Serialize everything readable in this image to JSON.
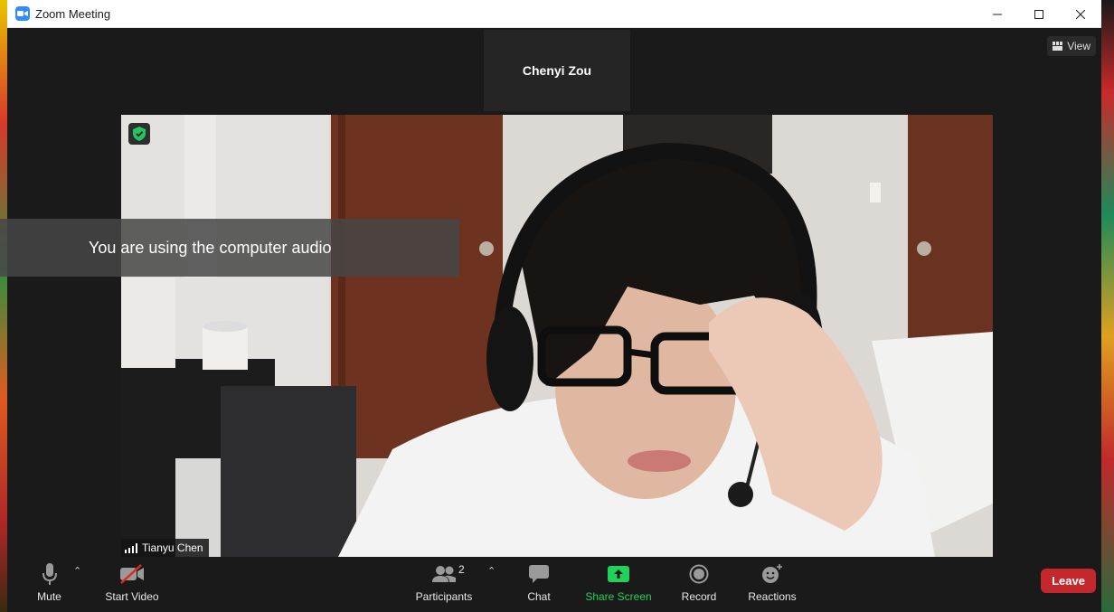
{
  "window": {
    "title": "Zoom Meeting"
  },
  "speaker": {
    "name": "Chenyi Zou"
  },
  "view": {
    "label": "View"
  },
  "video": {
    "participant_name": "Tianyu Chen"
  },
  "toast": {
    "message": "You are using the computer audio"
  },
  "toolbar": {
    "mute": "Mute",
    "start_video": "Start Video",
    "participants": "Participants",
    "participants_count": "2",
    "chat": "Chat",
    "share_screen": "Share Screen",
    "record": "Record",
    "reactions": "Reactions",
    "leave": "Leave"
  },
  "colors": {
    "share_green": "#21d25a",
    "leave_red": "#c4282c",
    "zoom_blue": "#2d8cff"
  }
}
